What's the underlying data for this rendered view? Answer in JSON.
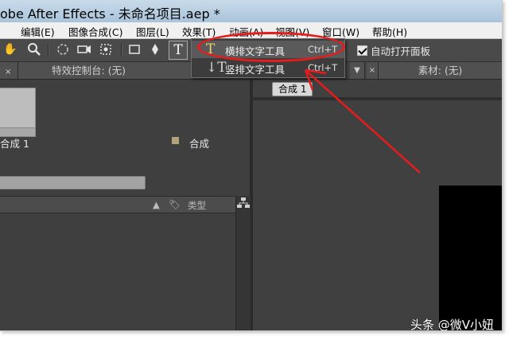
{
  "window": {
    "title": "obe After Effects - 未命名项目.aep *"
  },
  "menubar": {
    "items": [
      "编辑(E)",
      "图像合成(C)",
      "图层(L)",
      "效果(T)",
      "动画(A)",
      "视图(V)",
      "窗口(W)",
      "帮助(H)"
    ]
  },
  "toolbar": {
    "type_tool_glyph": "T",
    "auto_open_label": "自动打开面板",
    "auto_open_checked": true
  },
  "panels": {
    "effects_tab": "特效控制台: (无)",
    "footage_tab": "素材: (无)",
    "comp_tab": "合成 1",
    "project": {
      "type_column": "类型",
      "rows": [
        {
          "name": "合成 1",
          "type": "合成",
          "swatch_color": "#b4a07a"
        }
      ]
    }
  },
  "dropdown": {
    "items": [
      {
        "icon": "T",
        "label": "横排文字工具",
        "shortcut": "Ctrl+T",
        "highlighted": true
      },
      {
        "icon": "↓T",
        "label": "竖排文字工具",
        "shortcut": "Ctrl+T",
        "highlighted": false
      }
    ]
  },
  "annotation": {
    "color": "#e81b1b"
  },
  "watermark": "头条 @微V小妞"
}
